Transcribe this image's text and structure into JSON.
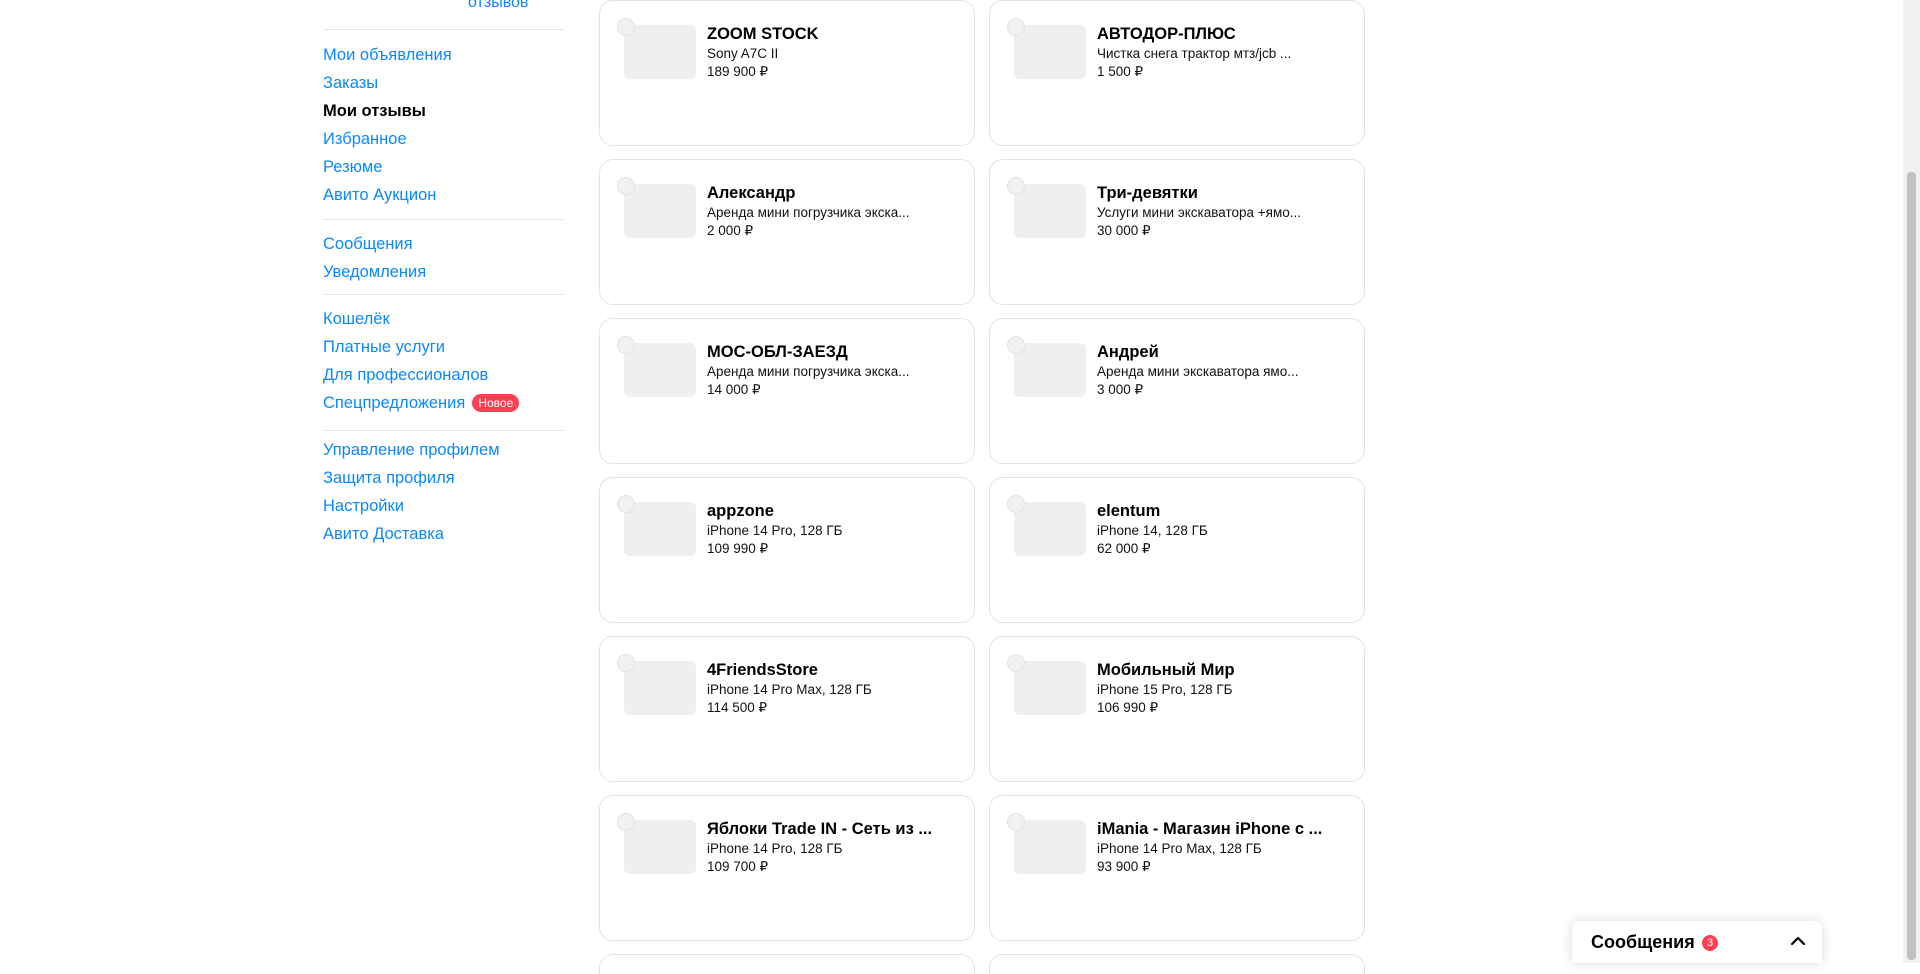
{
  "sidebar": {
    "rating_link": "отзывов",
    "groups": [
      [
        {
          "label": "Мои объявления",
          "active": false
        },
        {
          "label": "Заказы",
          "active": false
        },
        {
          "label": "Мои отзывы",
          "active": true
        },
        {
          "label": "Избранное",
          "active": false
        },
        {
          "label": "Резюме",
          "active": false
        },
        {
          "label": "Авито Аукцион",
          "active": false
        }
      ],
      [
        {
          "label": "Сообщения",
          "active": false
        },
        {
          "label": "Уведомления",
          "active": false
        }
      ],
      [
        {
          "label": "Кошелёк",
          "active": false
        },
        {
          "label": "Платные услуги",
          "active": false
        },
        {
          "label": "Для профессионалов",
          "active": false
        },
        {
          "label": "Спецпредложения",
          "active": false,
          "badge": "Новое"
        }
      ],
      [
        {
          "label": "Управление профилем",
          "active": false
        },
        {
          "label": "Защита профиля",
          "active": false
        },
        {
          "label": "Настройки",
          "active": false
        },
        {
          "label": "Авито Доставка",
          "active": false
        }
      ]
    ]
  },
  "cards": [
    {
      "seller": "ZOOM STOCK",
      "item": "Sony A7C II",
      "price": "189 900 ₽"
    },
    {
      "seller": "АВТОДОР-ПЛЮС",
      "item": "Чистка снега трактор мтз/jcb ...",
      "price": "1 500 ₽"
    },
    {
      "seller": "Александр",
      "item": "Аренда мини погрузчика экска...",
      "price": "2 000 ₽"
    },
    {
      "seller": "Три-девятки",
      "item": "Услуги мини экскаватора +ямо...",
      "price": "30 000 ₽"
    },
    {
      "seller": "МОС-ОБЛ-ЗАЕЗД",
      "item": "Аренда мини погрузчика экска...",
      "price": "14 000 ₽"
    },
    {
      "seller": "Андрей",
      "item": "Аренда мини экскаватора ямо...",
      "price": "3 000 ₽"
    },
    {
      "seller": "appzone",
      "item": "iPhone 14 Pro, 128 ГБ",
      "price": "109 990 ₽"
    },
    {
      "seller": "elentum",
      "item": "iPhone 14, 128 ГБ",
      "price": "62 000 ₽"
    },
    {
      "seller": "4FriendsStore",
      "item": "iPhone 14 Pro Max, 128 ГБ",
      "price": "114 500 ₽"
    },
    {
      "seller": "Мобильный Мир",
      "item": "iPhone 15 Pro, 128 ГБ",
      "price": "106 990 ₽"
    },
    {
      "seller": "Яблоки Trade IN - Сеть из ...",
      "item": "iPhone 14 Pro, 128 ГБ",
      "price": "109 700 ₽"
    },
    {
      "seller": "iMania - Магазин iPhone с ...",
      "item": "iPhone 14 Pro Max, 128 ГБ",
      "price": "93 900 ₽"
    }
  ],
  "messenger": {
    "title": "Сообщения",
    "count": "3"
  },
  "colors": {
    "link": "#0a88ff",
    "badge": "#ff4053",
    "border": "#e3e3e3"
  }
}
